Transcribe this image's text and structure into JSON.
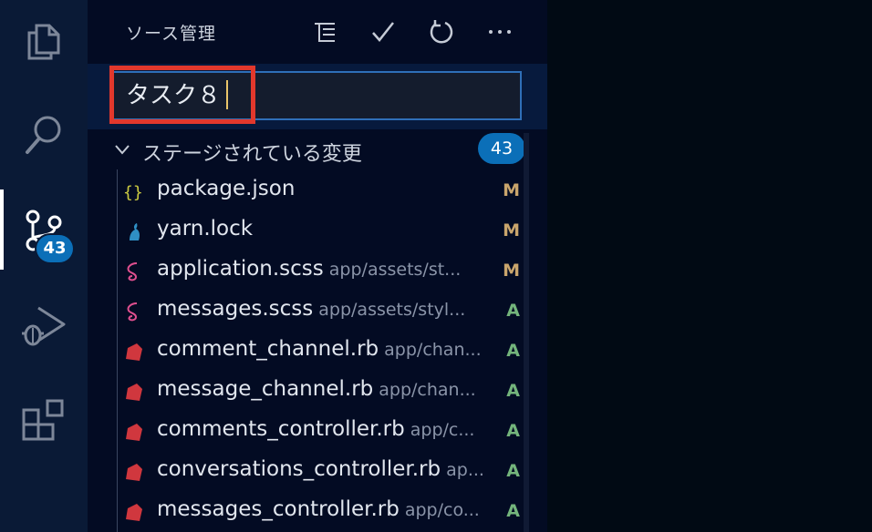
{
  "activity_bar": {
    "items": [
      {
        "icon": "files-icon"
      },
      {
        "icon": "search-icon"
      },
      {
        "icon": "source-control-icon",
        "badge": "43",
        "active": true
      },
      {
        "icon": "run-debug-icon"
      },
      {
        "icon": "extensions-icon"
      }
    ]
  },
  "sidebar": {
    "title": "ソース管理",
    "actions": [
      {
        "icon": "view-as-tree-icon"
      },
      {
        "icon": "commit-check-icon"
      },
      {
        "icon": "refresh-icon"
      },
      {
        "icon": "more-actions-icon"
      }
    ],
    "commit_message": "タスク８",
    "group": {
      "label": "ステージされている変更",
      "count": "43"
    },
    "files": [
      {
        "name": "package.json",
        "path": "",
        "status": "M",
        "icon": "json-file-icon",
        "icon_color": "#cbcb41"
      },
      {
        "name": "yarn.lock",
        "path": "",
        "status": "M",
        "icon": "yarn-file-icon",
        "icon_color": "#2f8fc4"
      },
      {
        "name": "application.scss",
        "path": "app/assets/st...",
        "status": "M",
        "icon": "sass-file-icon",
        "icon_color": "#e04f8f"
      },
      {
        "name": "messages.scss",
        "path": "app/assets/styl...",
        "status": "A",
        "icon": "sass-file-icon",
        "icon_color": "#e04f8f"
      },
      {
        "name": "comment_channel.rb",
        "path": "app/chan...",
        "status": "A",
        "icon": "ruby-file-icon",
        "icon_color": "#d0373e"
      },
      {
        "name": "message_channel.rb",
        "path": "app/chan...",
        "status": "A",
        "icon": "ruby-file-icon",
        "icon_color": "#d0373e"
      },
      {
        "name": "comments_controller.rb",
        "path": "app/c...",
        "status": "A",
        "icon": "ruby-file-icon",
        "icon_color": "#d0373e"
      },
      {
        "name": "conversations_controller.rb",
        "path": "ap...",
        "status": "A",
        "icon": "ruby-file-icon",
        "icon_color": "#d0373e"
      },
      {
        "name": "messages_controller.rb",
        "path": "app/co...",
        "status": "A",
        "icon": "ruby-file-icon",
        "icon_color": "#d0373e"
      }
    ]
  }
}
